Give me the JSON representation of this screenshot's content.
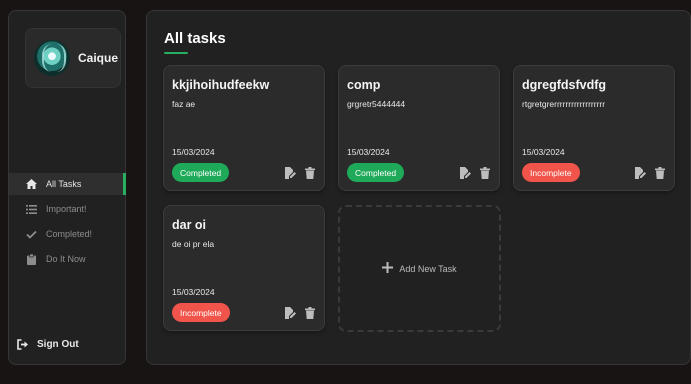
{
  "sidebar": {
    "username": "Caique",
    "items": [
      {
        "label": "All Tasks",
        "icon": "home-icon"
      },
      {
        "label": "Important!",
        "icon": "list-icon"
      },
      {
        "label": "Completed!",
        "icon": "check-icon"
      },
      {
        "label": "Do It Now",
        "icon": "clipboard-icon"
      }
    ],
    "signout_label": "Sign Out"
  },
  "main": {
    "title": "All tasks",
    "add_task_label": "Add New Task",
    "tasks": [
      {
        "title": "kkjihoihudfeekw",
        "description": "faz ae",
        "date": "15/03/2024",
        "status": "Completed"
      },
      {
        "title": "comp",
        "description": "grgretr5444444",
        "date": "15/03/2024",
        "status": "Completed"
      },
      {
        "title": "dgregfdsfvdfg",
        "description": "rtgretgrerrrrrrrrrrrrrrrrrr",
        "date": "15/03/2024",
        "status": "Incomplete"
      },
      {
        "title": "dar oi",
        "description": "de oi pr ela",
        "date": "15/03/2024",
        "status": "Incomplete"
      }
    ]
  },
  "colors": {
    "accent": "#27ae60",
    "completed": "#1faa59",
    "incomplete": "#f0544a"
  }
}
